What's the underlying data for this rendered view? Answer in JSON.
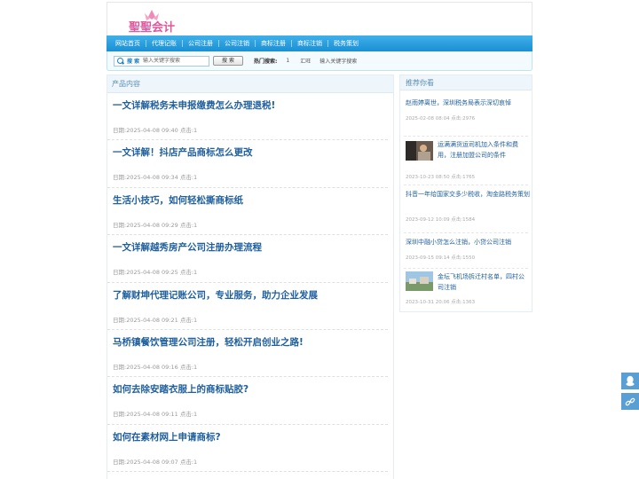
{
  "header": {
    "logo_text": "聖聖会计"
  },
  "nav": {
    "items": [
      "网站首页",
      "代理记账",
      "公司注册",
      "公司注销",
      "商标注册",
      "商标注销",
      "税务策划"
    ]
  },
  "search": {
    "label": "搜 索",
    "placeholder": "输入关键字搜索",
    "button": "搜 索",
    "hot_label": "热门搜索:",
    "hot_items": [
      "1",
      "汇旺",
      "输入关键字搜索"
    ]
  },
  "main": {
    "heading": "产品内容",
    "articles": [
      {
        "title": "一文详解税务未申报缴费怎么办理退税!",
        "meta": "日期:2025-04-08 09:40  点击:1"
      },
      {
        "title": "一文详解！抖店产品商标怎么更改",
        "meta": "日期:2025-04-08 09:34  点击:1"
      },
      {
        "title": "生活小技巧，如何轻松撕商标纸",
        "meta": "日期:2025-04-08 09:29  点击:1"
      },
      {
        "title": "一文详解越秀房产公司注册办理流程",
        "meta": "日期:2025-04-08 09:25  点击:1"
      },
      {
        "title": "了解财坤代理记账公司，专业服务，助力企业发展",
        "meta": "日期:2025-04-08 09:21  点击:1"
      },
      {
        "title": "马桥镇餐饮管理公司注册，轻松开启创业之路!",
        "meta": "日期:2025-04-08 09:16  点击:1"
      },
      {
        "title": "如何去除安踏衣服上的商标贴胶?",
        "meta": "日期:2025-04-08 09:11  点击:1"
      },
      {
        "title": "如何在素材网上申请商标?",
        "meta": "日期:2025-04-08 09:07  点击:1"
      }
    ]
  },
  "side": {
    "heading": "推荐你看",
    "items": [
      {
        "title": "赵雨婷离世，深圳税务局表示深切哀悼",
        "meta": "2025-02-08 08:04  点击:2976",
        "thumb": false
      },
      {
        "title": "运满满货运司机加入条件和费用，注册加盟公司的条件",
        "meta": "2023-10-23 08:50  点击:1765",
        "thumb": true
      },
      {
        "title": "抖音一年给国家交多少税收，淘金路税务策划",
        "meta": "2023-09-12 10:09  点击:1584",
        "thumb": false
      },
      {
        "title": "深圳中融小贷怎么注销，小贷公司注销",
        "meta": "2023-09-15 09:14  点击:1550",
        "thumb": false
      },
      {
        "title": "金坛飞机场拆迁村名单，四村公司注销",
        "meta": "2023-10-31 20:06  点击:1363",
        "thumb": true
      }
    ]
  },
  "colors": {
    "accent": "#1a8fd3",
    "link": "#1f5f9e",
    "logo": "#e0579b",
    "float": "#5a9fd4"
  },
  "float_buttons": [
    "qq-icon",
    "link-icon"
  ]
}
